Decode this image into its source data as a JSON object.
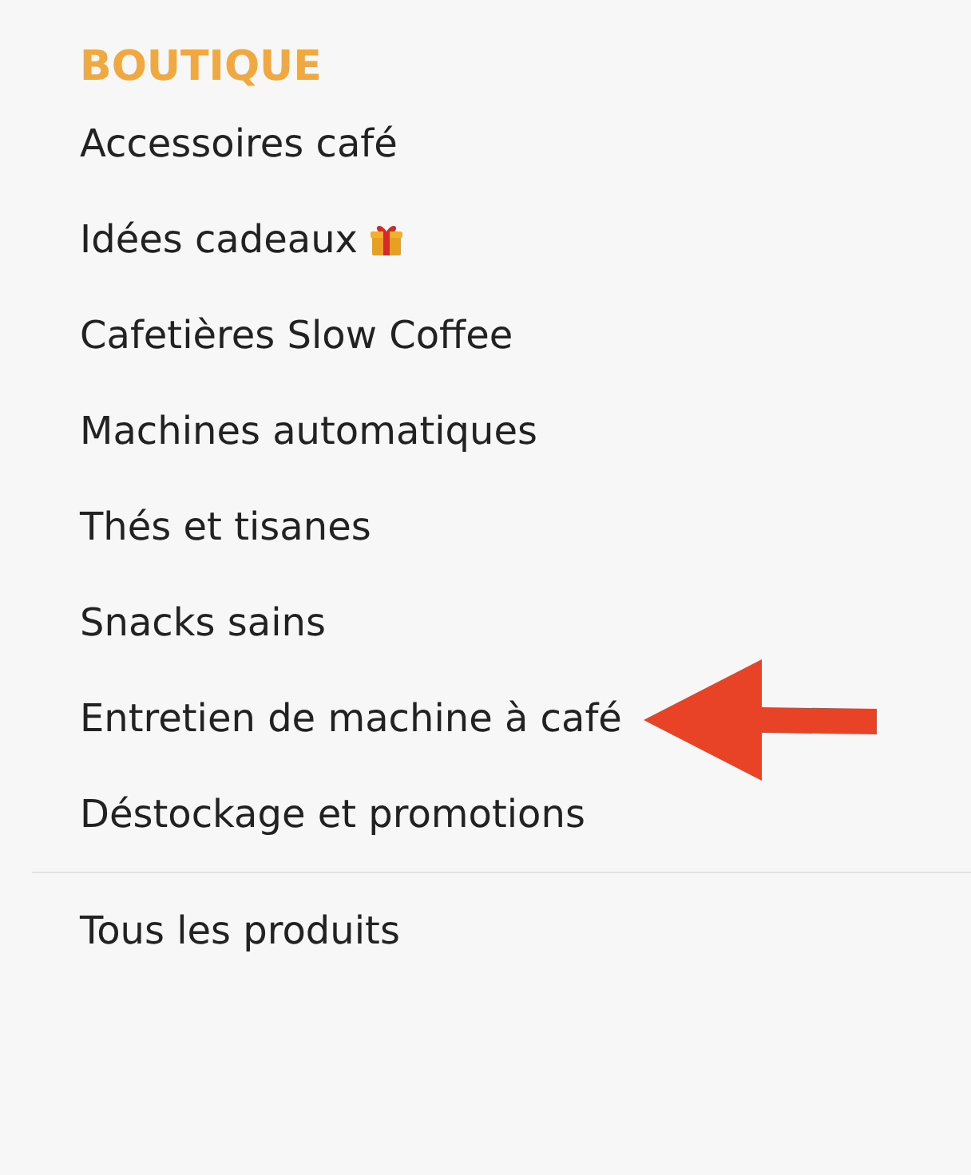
{
  "menu": {
    "heading": "BOUTIQUE",
    "items": [
      {
        "label": "Accessoires café",
        "kind": "plain",
        "pointed": false
      },
      {
        "label": "Idées cadeaux",
        "kind": "gift",
        "pointed": false
      },
      {
        "label": "Cafetières Slow Coffee",
        "kind": "plain",
        "pointed": false
      },
      {
        "label": "Machines automatiques",
        "kind": "plain",
        "pointed": false
      },
      {
        "label": "Thés et tisanes",
        "kind": "plain",
        "pointed": false
      },
      {
        "label": "Snacks sains",
        "kind": "plain",
        "pointed": false
      },
      {
        "label": "Entretien de machine à café",
        "kind": "plain",
        "pointed": true
      },
      {
        "label": "Déstockage et promotions",
        "kind": "plain",
        "pointed": false
      }
    ],
    "footer_items": [
      {
        "label": "Tous les produits"
      }
    ]
  }
}
